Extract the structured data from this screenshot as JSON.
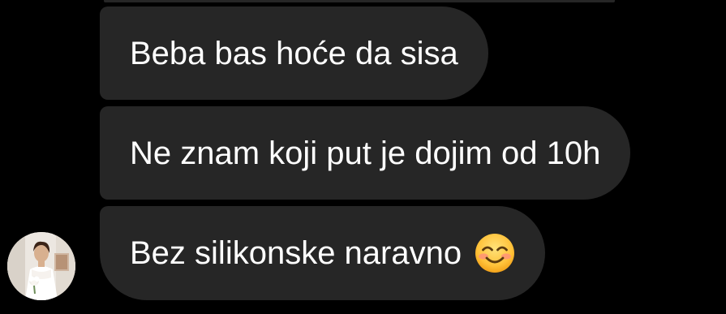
{
  "chat": {
    "messages": [
      {
        "text": "Beba bas hoće da sisa"
      },
      {
        "text": "Ne znam koji put je dojim od 10h"
      },
      {
        "text": "Bez silikonske naravno",
        "emoji": "smiling-face-with-smiling-eyes"
      }
    ]
  },
  "colors": {
    "background": "#000000",
    "bubble": "#262626",
    "text": "#ffffff"
  }
}
